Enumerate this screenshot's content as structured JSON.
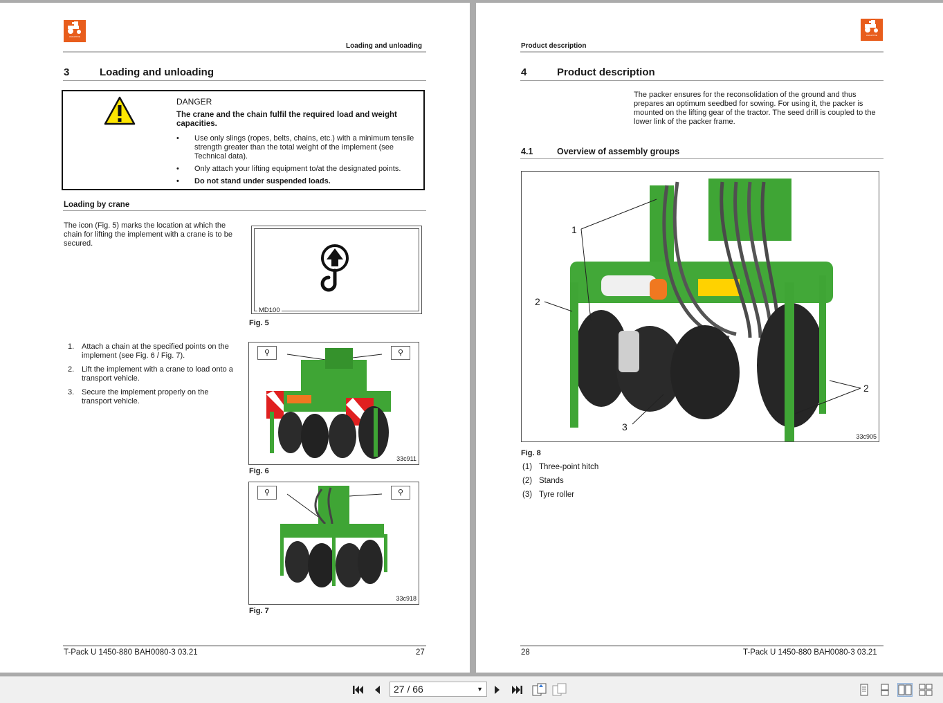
{
  "brand": {
    "logo_text": "AMAZONE"
  },
  "left_page": {
    "header": "Loading and unloading",
    "section_number": "3",
    "section_title": "Loading and unloading",
    "danger": {
      "title": "DANGER",
      "lead": "The crane and the chain fulfil the required load and weight capacities.",
      "bullets": [
        "Use only slings (ropes, belts, chains, etc.) with a minimum tensile strength greater than the total weight of the implement (see Technical data).",
        "Only attach your lifting equipment to/at the designated points.",
        "Do not stand under suspended loads."
      ]
    },
    "subsection_title": "Loading by crane",
    "intro": "The icon (Fig. 5) marks the location at which the chain for lifting the implement with a crane is to be secured.",
    "fig5": {
      "code": "MD100",
      "label": "Fig. 5"
    },
    "steps": [
      {
        "n": "1.",
        "text": "Attach a chain at the specified points on the implement (see Fig. 6 / Fig. 7)."
      },
      {
        "n": "2.",
        "text": "Lift the implement with a crane to load onto a transport vehicle."
      },
      {
        "n": "3.",
        "text": "Secure the implement properly on the transport vehicle."
      }
    ],
    "fig6": {
      "code": "33c911",
      "label": "Fig. 6"
    },
    "fig7": {
      "code": "33c918",
      "label": "Fig. 7"
    },
    "footer": {
      "doc": "T-Pack U 1450-880  BAH0080-3  03.21",
      "page": "27"
    }
  },
  "right_page": {
    "header": "Product description",
    "section_number": "4",
    "section_title": "Product description",
    "intro": "The packer ensures for the reconsolidation of the ground and thus prepares an optimum seedbed for sowing. For using it, the packer is mounted on the lifting gear of the tractor. The seed drill is coupled to the lower link of the packer frame.",
    "subsection_number": "4.1",
    "subsection_title": "Overview of assembly groups",
    "fig8": {
      "code": "33c905",
      "label": "Fig. 8",
      "callouts": {
        "c1": "1",
        "c2a": "2",
        "c2b": "2",
        "c3": "3"
      }
    },
    "legend": [
      {
        "key": "(1)",
        "text": "Three-point hitch"
      },
      {
        "key": "(2)",
        "text": "Stands"
      },
      {
        "key": "(3)",
        "text": "Tyre roller"
      }
    ],
    "footer": {
      "doc": "T-Pack U 1450-880  BAH0080-3  03.21",
      "page": "28"
    }
  },
  "toolbar": {
    "page_display": "27 / 66",
    "icons": [
      "first-page-icon",
      "previous-page-icon",
      "next-page-icon",
      "last-page-icon",
      "fit-page-icon",
      "fit-width-icon",
      "single-page-view-icon",
      "continuous-view-icon",
      "two-page-view-icon",
      "two-page-continuous-view-icon"
    ]
  },
  "colors": {
    "brand_orange": "#e85d1c",
    "implement_green": "#3fa535",
    "background": "#ababab"
  }
}
